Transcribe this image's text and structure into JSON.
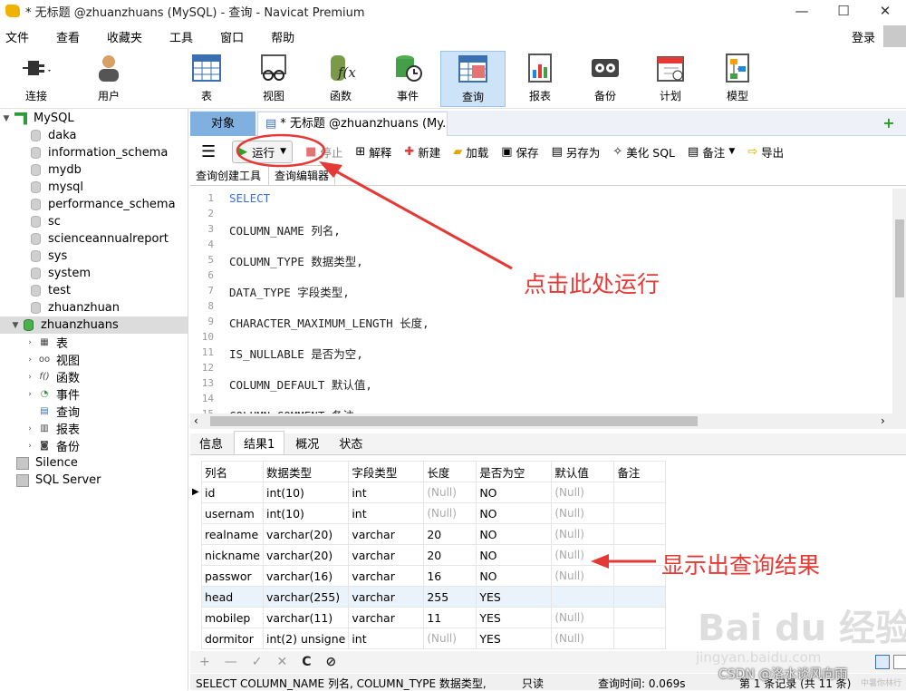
{
  "window": {
    "title": "* 无标题 @zhuanzhuans (MySQL) - 查询 - Navicat Premium",
    "controls": [
      "—",
      "☐",
      "✕"
    ]
  },
  "menu": {
    "items": [
      "文件",
      "查看",
      "收藏夹",
      "工具",
      "窗口",
      "帮助"
    ],
    "login": "登录"
  },
  "toolbar": {
    "buttons": [
      {
        "label": "连接",
        "icon": "plug-icon"
      },
      {
        "label": "用户",
        "icon": "user-icon"
      },
      {
        "label": "表",
        "icon": "table-icon"
      },
      {
        "label": "视图",
        "icon": "view-icon"
      },
      {
        "label": "函数",
        "icon": "function-icon"
      },
      {
        "label": "事件",
        "icon": "event-icon"
      },
      {
        "label": "查询",
        "icon": "query-icon"
      },
      {
        "label": "报表",
        "icon": "report-icon"
      },
      {
        "label": "备份",
        "icon": "backup-icon"
      },
      {
        "label": "计划",
        "icon": "calendar-icon"
      },
      {
        "label": "模型",
        "icon": "model-icon"
      }
    ],
    "selected": "查询"
  },
  "sidebar": {
    "root": "MySQL",
    "databases": [
      "daka",
      "information_schema",
      "mydb",
      "mysql",
      "performance_schema",
      "sc",
      "scienceannualreport",
      "sys",
      "system",
      "test",
      "zhuanzhuan",
      "zhuanzhuans"
    ],
    "open_db": "zhuanzhuans",
    "children": [
      {
        "label": "表",
        "icon": "table-icon"
      },
      {
        "label": "视图",
        "icon": "view-icon"
      },
      {
        "label": "函数",
        "icon": "function-icon"
      },
      {
        "label": "事件",
        "icon": "event-icon"
      },
      {
        "label": "查询",
        "icon": "query-icon"
      },
      {
        "label": "报表",
        "icon": "report-icon"
      },
      {
        "label": "备份",
        "icon": "backup-icon"
      }
    ],
    "connections": [
      "Silence",
      "SQL Server"
    ]
  },
  "tabs": {
    "objects": "对象",
    "query": "* 无标题 @zhuanzhuans (My..."
  },
  "query_toolbar": {
    "run": "运行",
    "stop": "停止",
    "explain": "解释",
    "new": "新建",
    "load": "加载",
    "save": "保存",
    "save_as": "另存为",
    "beautify": "美化 SQL",
    "comment": "备注",
    "export": "导出"
  },
  "editor_tabs": [
    "查询创建工具",
    "查询编辑器"
  ],
  "editor": {
    "lines": [
      {
        "n": "1",
        "text": "SELECT",
        "kw": true
      },
      {
        "n": "2",
        "text": ""
      },
      {
        "n": "3",
        "text": "COLUMN_NAME 列名,"
      },
      {
        "n": "4",
        "text": ""
      },
      {
        "n": "5",
        "text": "COLUMN_TYPE 数据类型,"
      },
      {
        "n": "6",
        "text": ""
      },
      {
        "n": "7",
        "text": "DATA_TYPE 字段类型,"
      },
      {
        "n": "8",
        "text": ""
      },
      {
        "n": "9",
        "text": "CHARACTER_MAXIMUM_LENGTH 长度,"
      },
      {
        "n": "10",
        "text": ""
      },
      {
        "n": "11",
        "text": "IS_NULLABLE 是否为空,"
      },
      {
        "n": "12",
        "text": ""
      },
      {
        "n": "13",
        "text": "COLUMN_DEFAULT 默认值,"
      },
      {
        "n": "14",
        "text": ""
      },
      {
        "n": "15",
        "text": "COLUMN_COMMENT 备注"
      }
    ]
  },
  "result_tabs": [
    "信息",
    "结果1",
    "概况",
    "状态"
  ],
  "result": {
    "columns": [
      "列名",
      "数据类型",
      "字段类型",
      "长度",
      "是否为空",
      "默认值",
      "备注"
    ],
    "rows": [
      [
        "id",
        "int(10)",
        "int",
        "(Null)",
        "NO",
        "(Null)",
        ""
      ],
      [
        "usernam",
        "int(10)",
        "int",
        "(Null)",
        "NO",
        "(Null)",
        ""
      ],
      [
        "realname",
        "varchar(20)",
        "varchar",
        "20",
        "NO",
        "(Null)",
        ""
      ],
      [
        "nickname",
        "varchar(20)",
        "varchar",
        "20",
        "NO",
        "(Null)",
        ""
      ],
      [
        "passwor",
        "varchar(16)",
        "varchar",
        "16",
        "NO",
        "(Null)",
        ""
      ],
      [
        "head",
        "varchar(255)",
        "varchar",
        "255",
        "YES",
        "",
        ""
      ],
      [
        "mobilep",
        "varchar(11)",
        "varchar",
        "11",
        "YES",
        "(Null)",
        ""
      ],
      [
        "dormitor",
        "int(2) unsigne",
        "int",
        "(Null)",
        "YES",
        "(Null)",
        ""
      ]
    ]
  },
  "grid_nav": [
    "+",
    "—",
    "✓",
    "✕",
    "C",
    "⊘"
  ],
  "status": {
    "sql": "SELECT   COLUMN_NAME 列名,   COLUMN_TYPE 数据类型,",
    "readonly": "只读",
    "time": "查询时间: 0.069s",
    "records": "第 1 条记录 (共 11 条)"
  },
  "annotations": {
    "run_hint": "点击此处运行",
    "result_hint": "显示出查询结果"
  },
  "watermark": {
    "baidu": "Bai du 经验",
    "url": "jingyan.baidu.com",
    "csdn": "CSDN @洛水谈风向雨",
    "small": "中暑你林行"
  },
  "colors": {
    "annotation": "#e53935",
    "tab_active": "#7fb0e0",
    "selected_toolbar": "#cde3f7"
  }
}
